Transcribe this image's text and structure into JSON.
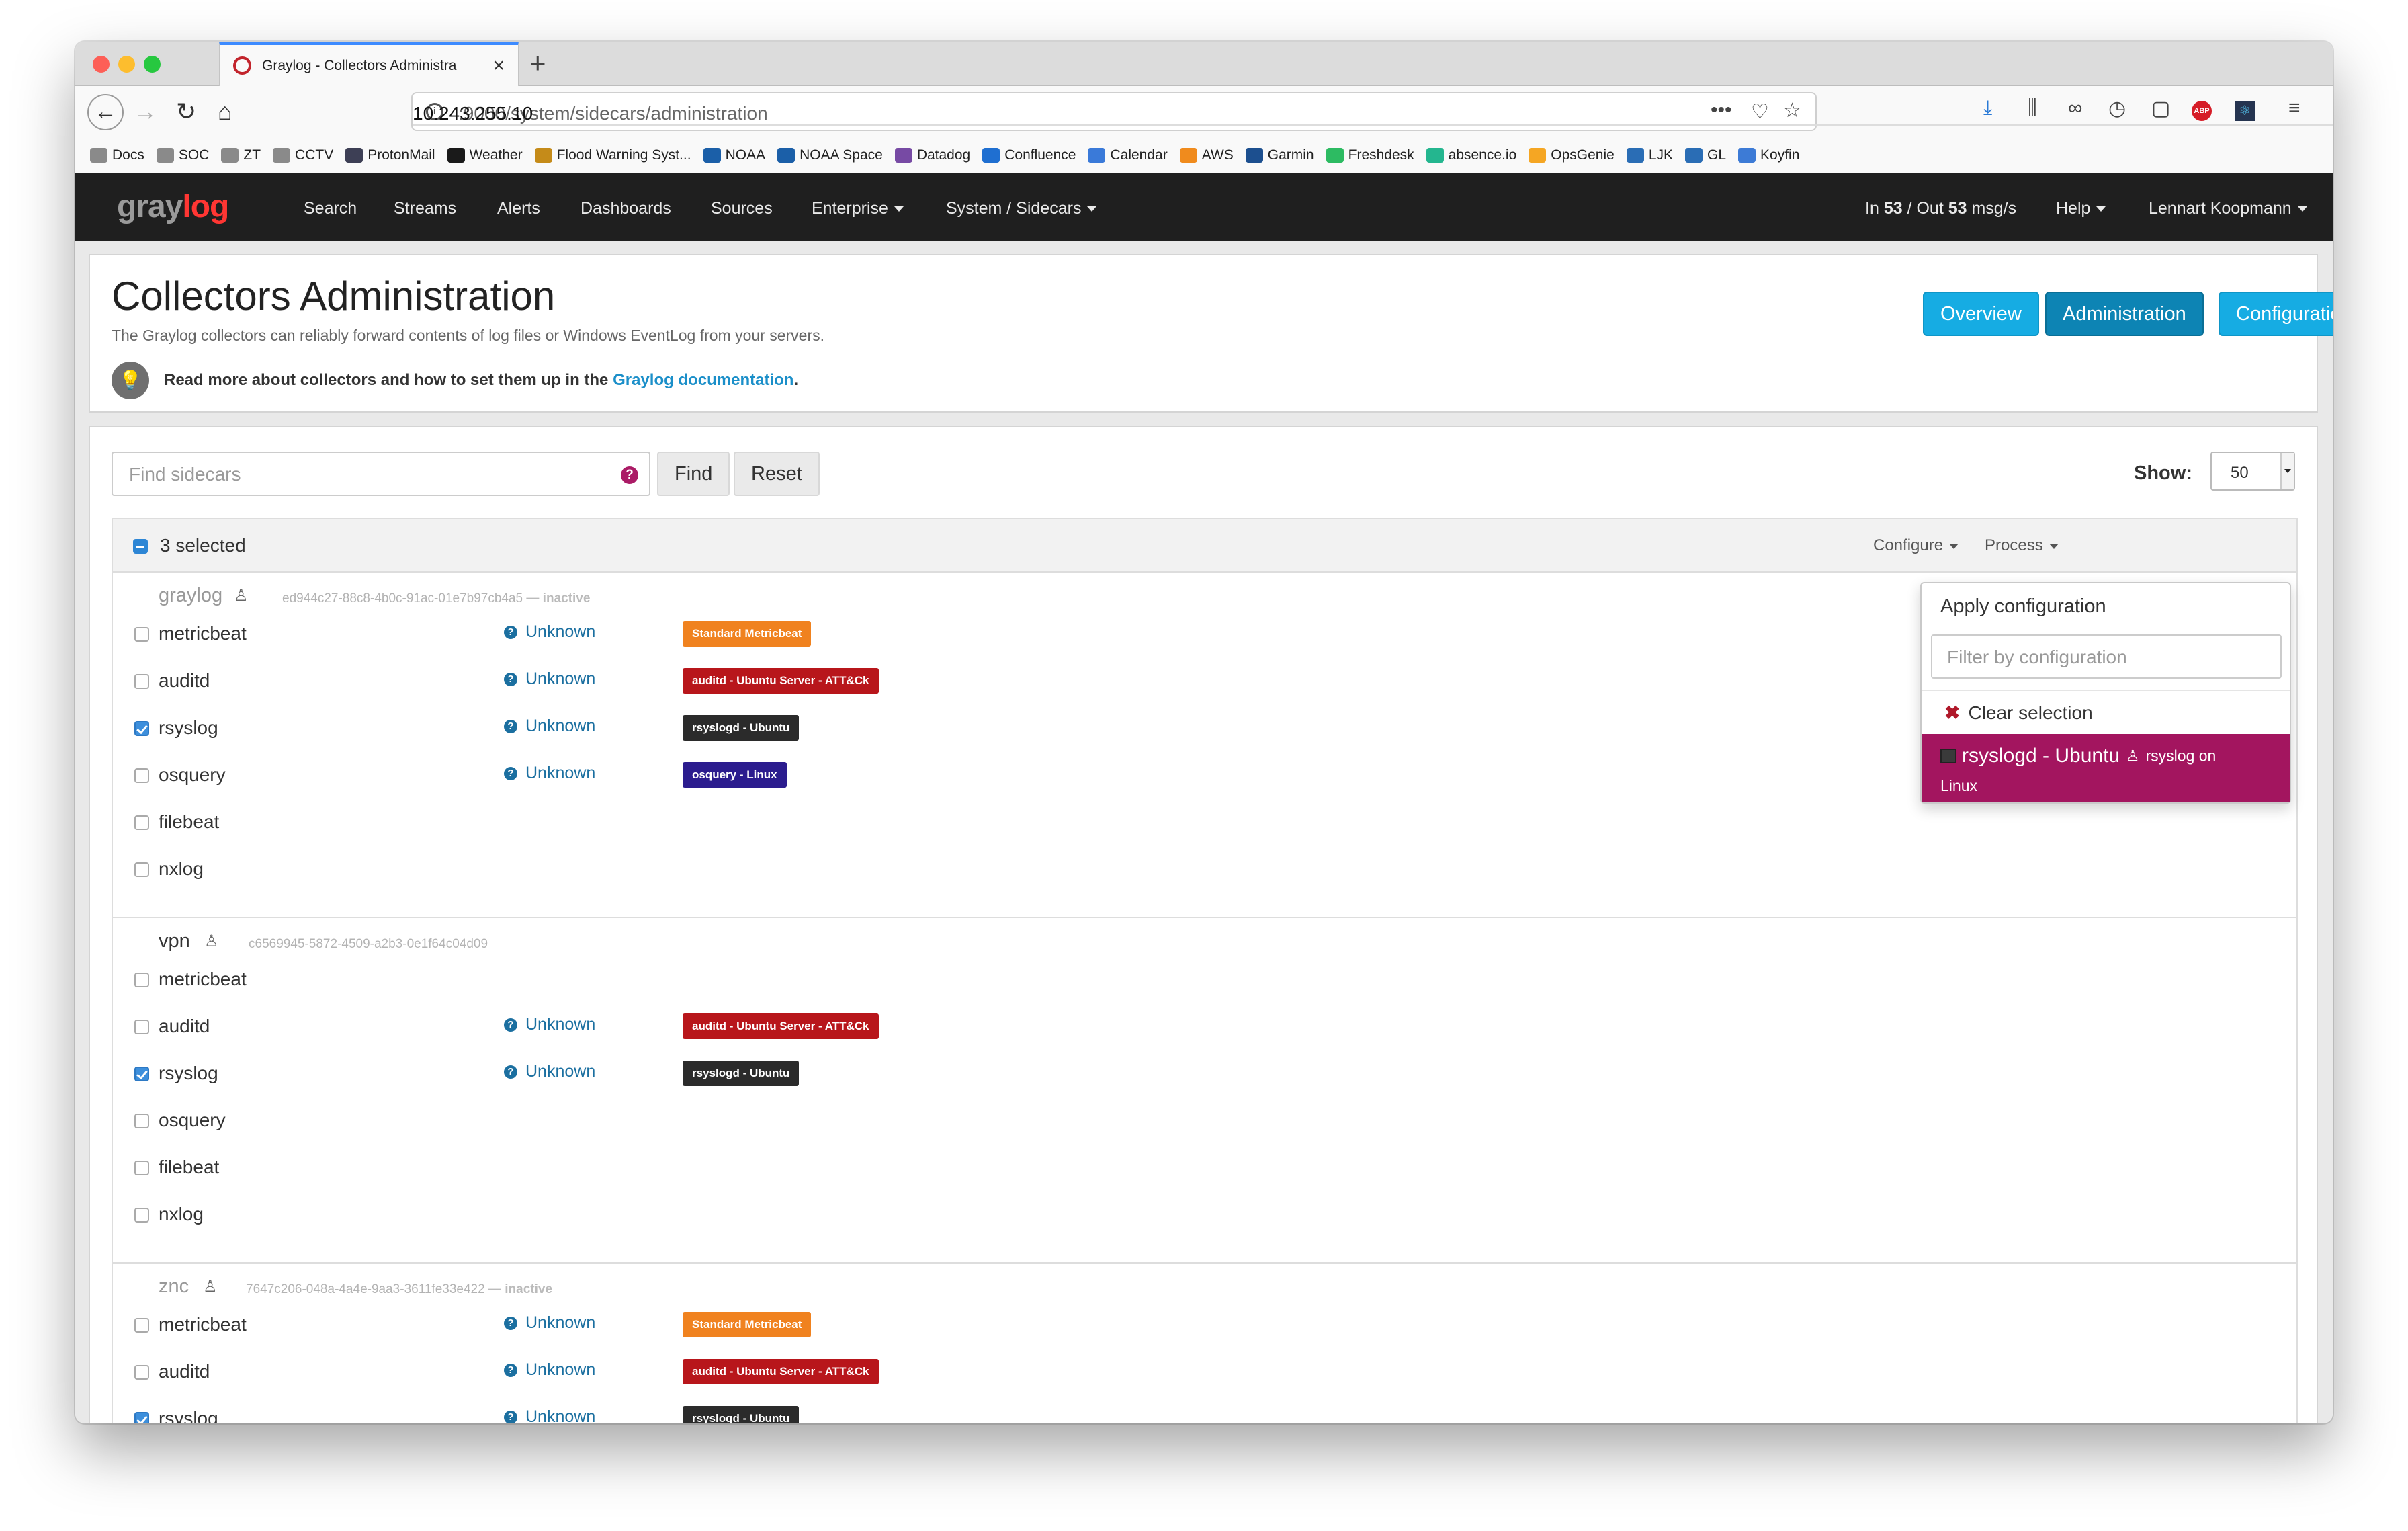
{
  "browser": {
    "tab_title": "Graylog - Collectors Administra",
    "url_host": "10.243.255.10",
    "url_path": ":9000/system/sidecars/administration",
    "bookmarks": [
      {
        "label": "Docs",
        "color": "#8a8a8a"
      },
      {
        "label": "SOC",
        "color": "#8a8a8a"
      },
      {
        "label": "ZT",
        "color": "#8a8a8a"
      },
      {
        "label": "CCTV",
        "color": "#8a8a8a"
      },
      {
        "label": "ProtonMail",
        "color": "#3d3f55"
      },
      {
        "label": "Weather",
        "color": "#1a1a1a"
      },
      {
        "label": "Flood Warning Syst...",
        "color": "#c58b19"
      },
      {
        "label": "NOAA",
        "color": "#1b5fa8"
      },
      {
        "label": "NOAA Space",
        "color": "#1b5fa8"
      },
      {
        "label": "Datadog",
        "color": "#774aa4"
      },
      {
        "label": "Confluence",
        "color": "#1f6fd1"
      },
      {
        "label": "Calendar",
        "color": "#3a7ad9"
      },
      {
        "label": "AWS",
        "color": "#f08b1d"
      },
      {
        "label": "Garmin",
        "color": "#1c4f8f"
      },
      {
        "label": "Freshdesk",
        "color": "#2dbb62"
      },
      {
        "label": "absence.io",
        "color": "#24b68f"
      },
      {
        "label": "OpsGenie",
        "color": "#f5a623"
      },
      {
        "label": "LJK",
        "color": "#2a6db5"
      },
      {
        "label": "GL",
        "color": "#2a6db5"
      },
      {
        "label": "Koyfin",
        "color": "#3d7bd6"
      }
    ]
  },
  "graylog_nav": {
    "logo_gray": "gray",
    "logo_red": "log",
    "items": [
      "Search",
      "Streams",
      "Alerts",
      "Dashboards",
      "Sources"
    ],
    "enterprise": "Enterprise",
    "system": "System / Sidecars",
    "throughput_in_label": "In",
    "throughput_in": "53",
    "throughput_sep": "/ Out",
    "throughput_out": "53",
    "throughput_unit": "msg/s",
    "help": "Help",
    "user": "Lennart Koopmann"
  },
  "header": {
    "title": "Collectors Administration",
    "subtitle": "The Graylog collectors can reliably forward contents of log files or Windows EventLog from your servers.",
    "tip_text": "Read more about collectors and how to set them up in the",
    "tip_link": "Graylog documentation",
    "tip_end": ".",
    "buttons": [
      "Overview",
      "Administration",
      "Configuration"
    ]
  },
  "toolbar": {
    "search_placeholder": "Find sidecars",
    "find": "Find",
    "reset": "Reset",
    "show_label": "Show:",
    "show_value": "50"
  },
  "table": {
    "selected_label": "3 selected",
    "configure": "Configure",
    "process": "Process"
  },
  "hosts": [
    {
      "name": "graylog",
      "id": "ed944c27-88c8-4b0c-91ac-01e7b97cb4a5",
      "state": "— inactive",
      "rows": [
        {
          "name": "metricbeat",
          "checked": false,
          "status": "Unknown",
          "badge": "Standard Metricbeat",
          "badge_color": "#f0821f"
        },
        {
          "name": "auditd",
          "checked": false,
          "status": "Unknown",
          "badge": "auditd - Ubuntu Server - ATT&Ck",
          "badge_color": "#b8161b"
        },
        {
          "name": "rsyslog",
          "checked": true,
          "status": "Unknown",
          "badge": "rsyslogd - Ubuntu",
          "badge_color": "#2b2b2b"
        },
        {
          "name": "osquery",
          "checked": false,
          "status": "Unknown",
          "badge": "osquery - Linux",
          "badge_color": "#2b1c8e"
        },
        {
          "name": "filebeat",
          "checked": false,
          "status": "",
          "badge": "",
          "badge_color": ""
        },
        {
          "name": "nxlog",
          "checked": false,
          "status": "",
          "badge": "",
          "badge_color": ""
        }
      ]
    },
    {
      "name": "vpn",
      "id": "c6569945-5872-4509-a2b3-0e1f64c04d09",
      "state": "",
      "rows": [
        {
          "name": "metricbeat",
          "checked": false,
          "status": "",
          "badge": "",
          "badge_color": ""
        },
        {
          "name": "auditd",
          "checked": false,
          "status": "Unknown",
          "badge": "auditd - Ubuntu Server - ATT&Ck",
          "badge_color": "#b8161b"
        },
        {
          "name": "rsyslog",
          "checked": true,
          "status": "Unknown",
          "badge": "rsyslogd - Ubuntu",
          "badge_color": "#2b2b2b"
        },
        {
          "name": "osquery",
          "checked": false,
          "status": "",
          "badge": "",
          "badge_color": ""
        },
        {
          "name": "filebeat",
          "checked": false,
          "status": "",
          "badge": "",
          "badge_color": ""
        },
        {
          "name": "nxlog",
          "checked": false,
          "status": "",
          "badge": "",
          "badge_color": ""
        }
      ]
    },
    {
      "name": "znc",
      "id": "7647c206-048a-4a4e-9aa3-3611fe33e422",
      "state": "— inactive",
      "rows": [
        {
          "name": "metricbeat",
          "checked": false,
          "status": "Unknown",
          "badge": "Standard Metricbeat",
          "badge_color": "#f0821f"
        },
        {
          "name": "auditd",
          "checked": false,
          "status": "Unknown",
          "badge": "auditd - Ubuntu Server - ATT&Ck",
          "badge_color": "#b8161b"
        },
        {
          "name": "rsyslog",
          "checked": true,
          "status": "Unknown",
          "badge": "rsyslogd - Ubuntu",
          "badge_color": "#2b2b2b"
        }
      ]
    }
  ],
  "config_menu": {
    "header": "Apply configuration",
    "filter_placeholder": "Filter by configuration",
    "clear": "Clear selection",
    "option_name": "rsyslogd - Ubuntu",
    "option_desc": "rsyslog on",
    "option_os": "Linux"
  }
}
